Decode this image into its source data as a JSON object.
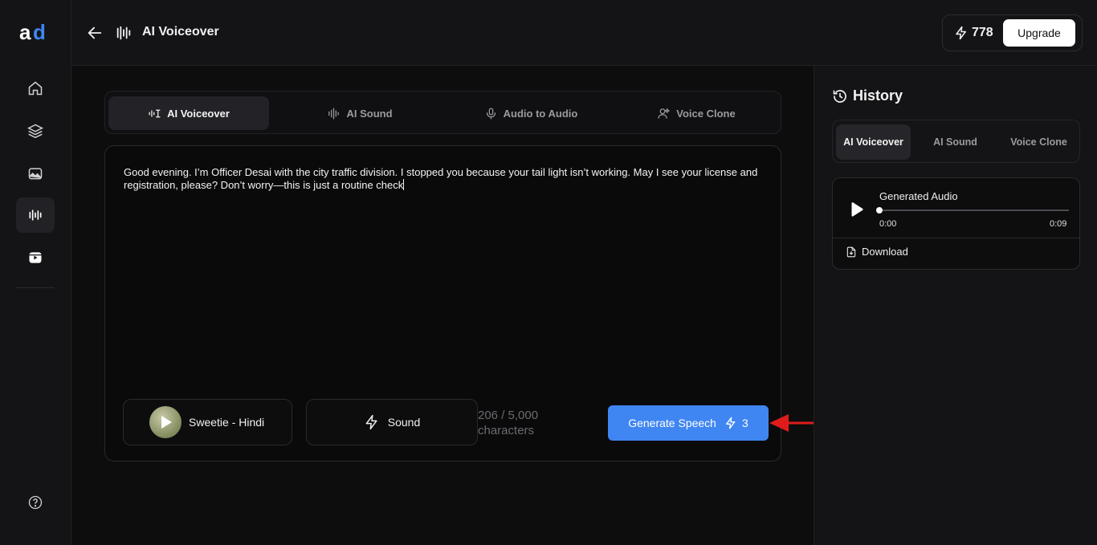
{
  "app": {
    "logo_text": "ad"
  },
  "header": {
    "title": "AI Voiceover",
    "credits": "778",
    "upgrade_label": "Upgrade"
  },
  "sidebar": {
    "items": [
      {
        "icon": "home-icon"
      },
      {
        "icon": "layers-icon"
      },
      {
        "icon": "ai-image-icon"
      },
      {
        "icon": "audio-wave-icon",
        "active": true
      },
      {
        "icon": "video-icon"
      },
      {
        "icon": "help-icon"
      }
    ]
  },
  "tabs": [
    {
      "label": "AI Voiceover",
      "icon": "voiceover-icon",
      "active": true
    },
    {
      "label": "AI Sound",
      "icon": "sound-wave-icon"
    },
    {
      "label": "Audio to Audio",
      "icon": "microphone-icon"
    },
    {
      "label": "Voice Clone",
      "icon": "voice-clone-icon"
    }
  ],
  "editor": {
    "text": "Good evening. I’m Officer Desai with the city traffic division. I stopped you because your tail light isn’t working. May I see your license and registration, please? Don’t worry—this is just a routine check",
    "voice_label": "Sweetie - Hindi",
    "sound_label": "Sound",
    "char_count": "206 / 5,000",
    "char_unit": "characters",
    "generate_label": "Generate Speech",
    "generate_cost": "3"
  },
  "history": {
    "title": "History",
    "tabs": [
      {
        "label": "AI Voiceover",
        "active": true
      },
      {
        "label": "AI Sound"
      },
      {
        "label": "Voice Clone"
      }
    ],
    "card": {
      "title": "Generated Audio",
      "time_start": "0:00",
      "time_end": "0:09",
      "progress": 0,
      "download_label": "Download"
    }
  },
  "colors": {
    "accent": "#3f86f2",
    "logo_blue": "#3f86f2",
    "annotation_arrow": "#e01b1b"
  }
}
